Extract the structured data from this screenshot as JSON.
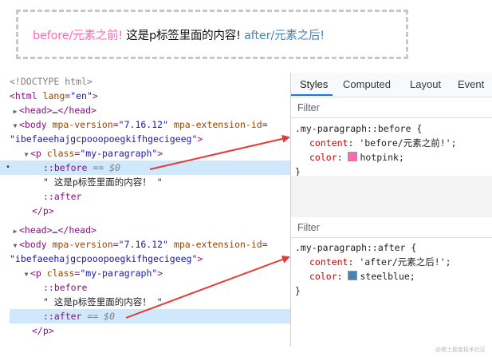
{
  "demo": {
    "before": "before/元素之前!",
    "middle": " 这是p标签里面的内容! ",
    "after": "after/元素之后!"
  },
  "colors": {
    "hotpink": "#ff69b4",
    "steelblue": "#4682b4",
    "arrow": "#e53935",
    "selection": "#cfe8fc"
  },
  "tree": {
    "doctype": "<!DOCTYPE html>",
    "html_open": "<html",
    "lang_attr": "lang",
    "lang_val": "\"en\"",
    "head_open": "<head>",
    "head_ellipsis": "…",
    "head_close": "</head>",
    "body_open": "<body",
    "mpa_version_attr": "mpa-version",
    "mpa_version_val": "\"7.16.12\"",
    "mpa_ext_attr": "mpa-extension-id",
    "mpa_ext_val": "\"ibefaeehajgcpooopoegkifhgecigeeg\"",
    "p_open": "<p",
    "class_attr": "class",
    "class_val": "\"my-paragraph\"",
    "before_pseudo": "::before",
    "after_pseudo": "::after",
    "eq_var": " == $0",
    "text_node": "\" 这是p标签里面的内容！ \"",
    "p_close": "</p>",
    "gt": ">",
    "eq": "="
  },
  "styles_panel": {
    "tabs": [
      "Styles",
      "Computed",
      "Layout",
      "Event"
    ],
    "filter_label": "Filter",
    "before_rule": {
      "selector": ".my-paragraph::before {",
      "prop1": "content",
      "val1": "'before/元素之前!';",
      "prop2": "color",
      "val2": "hotpink;",
      "close": "}"
    },
    "after_rule": {
      "selector": ".my-paragraph::after {",
      "prop1": "content",
      "val1": "'after/元素之后!';",
      "prop2": "color",
      "val2": "steelblue;",
      "close": "}"
    }
  },
  "watermark": "@稀土掘金技术社区"
}
